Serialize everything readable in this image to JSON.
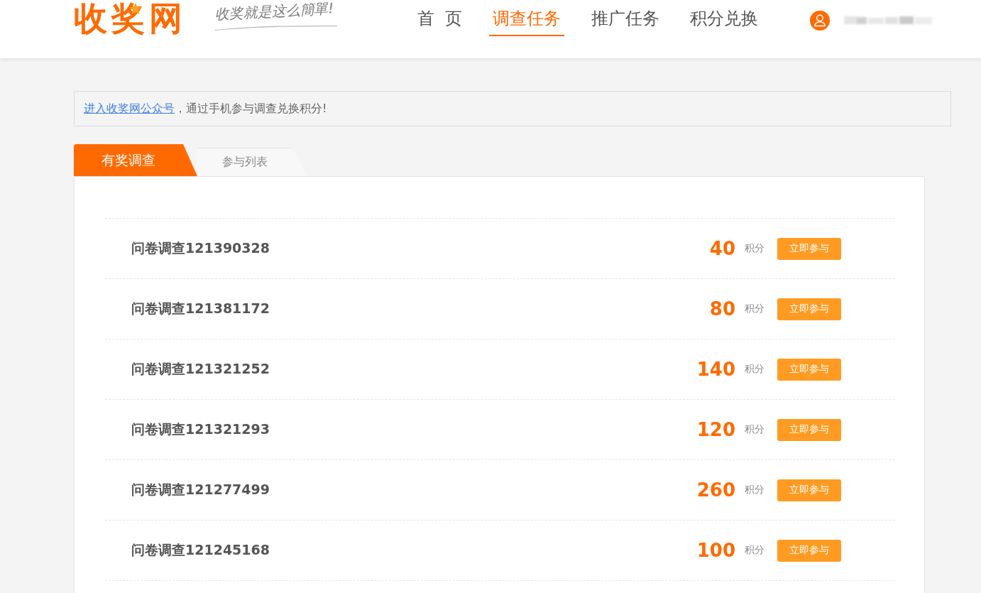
{
  "header": {
    "logo": "收奖网",
    "slogan": "收奖就是这么簡單!",
    "nav": [
      {
        "label": "首 页",
        "selected": false
      },
      {
        "label": "调查任务",
        "selected": true
      },
      {
        "label": "推广任务",
        "selected": false
      },
      {
        "label": "积分兑换",
        "selected": false
      }
    ]
  },
  "notice": {
    "link": "进入收奖网公众号",
    "text": "，通过手机参与调查兑换积分!"
  },
  "tabs": [
    {
      "label": "有奖调查",
      "selected": true
    },
    {
      "label": "参与列表",
      "selected": false
    }
  ],
  "surveys": [
    {
      "title": "问卷调查121390328",
      "points": "40",
      "unit": "积分",
      "button": "立即参与"
    },
    {
      "title": "问卷调查121381172",
      "points": "80",
      "unit": "积分",
      "button": "立即参与"
    },
    {
      "title": "问卷调查121321252",
      "points": "140",
      "unit": "积分",
      "button": "立即参与"
    },
    {
      "title": "问卷调查121321293",
      "points": "120",
      "unit": "积分",
      "button": "立即参与"
    },
    {
      "title": "问卷调查121277499",
      "points": "260",
      "unit": "积分",
      "button": "立即参与"
    },
    {
      "title": "问卷调查121245168",
      "points": "100",
      "unit": "积分",
      "button": "立即参与"
    }
  ]
}
